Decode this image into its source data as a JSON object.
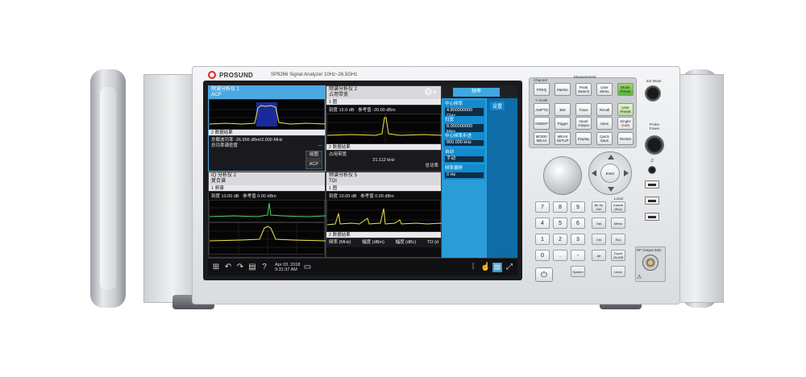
{
  "brand": {
    "name": "PROSUND",
    "model": "SP9266 Signal Analyzer 10Hz~26.5GHz"
  },
  "screen": {
    "top_menu_label": "频率",
    "settings_label": "设置",
    "panes": {
      "p1": {
        "title": "频谱分析仪 1",
        "subtitle": "ACP",
        "marker": "",
        "rows": [
          "2 数据结果"
        ],
        "results": [
          {
            "label": "总载波功率",
            "value": "-26.956 dBm/2.000 MHz"
          },
          {
            "label": "总功率谱密度",
            "value": "---"
          }
        ],
        "btn1": "绘图",
        "btn2": "ACP"
      },
      "p2": {
        "title": "频谱分析仪 2",
        "subtitle": "占用带宽",
        "trace_row": "1 图",
        "readout_left": "刻度 15.0 dB",
        "readout_right": "参考值 -20.00 dBm",
        "rows": [
          "2 数据结果"
        ],
        "obw_label": "占用带宽",
        "obw_value": "21.112 kHz",
        "power_label": "总功率"
      },
      "p3": {
        "title": "IQ 分析仪 2",
        "subtitle": "复合谱",
        "trace_row": "1 频谱",
        "readout_left": "刻度 10.00 dB",
        "readout_right": "参考值 0.00 dBm"
      },
      "p4": {
        "title": "频谱分析仪 5",
        "subtitle": "TOI",
        "trace_row": "1 图",
        "readout_left": "刻度 10.00 dB",
        "readout_right": "参考值 0.00 dBm",
        "rows": [
          "2 数据结果"
        ],
        "table_headers": [
          "频率 (MHz)",
          "幅度 (dBm)",
          "幅度 (dBc)",
          "TO (d"
        ]
      }
    },
    "menu": [
      {
        "label": "中心频率",
        "value": "4.800000000 GHz"
      },
      {
        "label": "扫宽",
        "value": "8.000000000 MHz"
      },
      {
        "label": "中心频率步进",
        "value": "800.000 kHz"
      },
      {
        "label": "自动",
        "value": "手动"
      },
      {
        "label": "频率偏移",
        "value": "0 Hz"
      }
    ],
    "taskbar": {
      "date": "Apr 03, 2018",
      "time": "9:31:37 AM"
    }
  },
  "keys": {
    "groups": {
      "channel": "Channel",
      "measurement": "Measurement",
      "y_scale": "Y Scale",
      "x_scale": "X Scale"
    },
    "soft": [
      [
        "FREQ",
        "Marker",
        "Peak Search",
        "User Menu",
        "Mode Preset"
      ],
      [
        "AMPTD",
        "BW",
        "Trace",
        "Recall",
        "User Preset"
      ],
      [
        "SWEEP",
        "Trigger",
        "Input/ Output",
        "Save",
        "Single/ Cont"
      ],
      [
        "MODE/ MEAS",
        "MEAS SETUP",
        "Display",
        "Quick Save",
        "Restart"
      ]
    ],
    "numpad": [
      "7",
      "8",
      "9",
      "4",
      "5",
      "6",
      "1",
      "2",
      "3",
      "0",
      ".",
      "-"
    ],
    "side": [
      "Bk Sp Del",
      "Tab",
      "Ctrl",
      "Alt",
      "Esc",
      "Menu",
      "Cancel (Esc)",
      "Touch On/Off",
      "Undo",
      "System"
    ],
    "local_label": "Local",
    "enter_label": "Enter",
    "ports": {
      "ext_mixer": "Ext Mixer",
      "probe_power": "Probe Power",
      "rf_input": "RF Output 50Ω"
    }
  }
}
